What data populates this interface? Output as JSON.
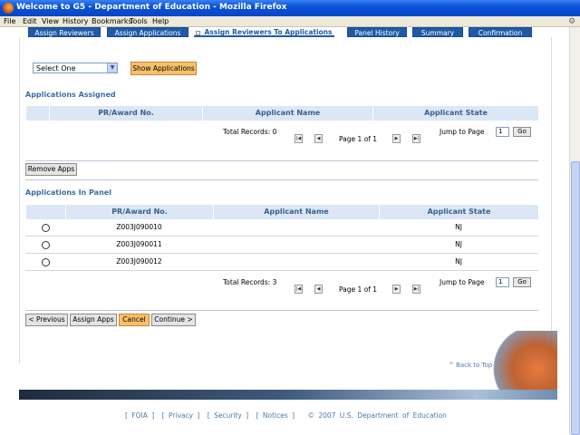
{
  "window": {
    "title": "Welcome to G5 - Department of Education - Mozilla Firefox"
  },
  "menu": [
    "File",
    "Edit",
    "View",
    "History",
    "Bookmarks",
    "Tools",
    "Help"
  ],
  "tabs": [
    {
      "label": "Assign Reviewers",
      "active": false
    },
    {
      "label": "Assign Applications",
      "active": false
    },
    {
      "label": "Assign Reviewers To Applications",
      "active": true
    },
    {
      "label": "Panel History",
      "active": false
    },
    {
      "label": "Summary",
      "active": false
    },
    {
      "label": "Confirmation",
      "active": false
    }
  ],
  "filter": {
    "select_value": "Select One",
    "show_button": "Show Applications"
  },
  "assigned": {
    "title": "Applications Assigned",
    "columns": [
      "PR/Award No.",
      "Applicant Name",
      "Applicant State"
    ],
    "total": "Total Records: 0",
    "page_label": "Page 1 of 1",
    "jump_label": "Jump to Page",
    "page_value": "1",
    "go_label": "Go",
    "remove_button": "Remove Apps"
  },
  "panel": {
    "title": "Applications In Panel",
    "columns": [
      "PR/Award No.",
      "Applicant Name",
      "Applicant State"
    ],
    "rows": [
      {
        "award": "Z003J090010",
        "name": "",
        "state": "NJ"
      },
      {
        "award": "Z003J090011",
        "name": "",
        "state": "NJ"
      },
      {
        "award": "Z003J090012",
        "name": "",
        "state": "NJ"
      }
    ],
    "total": "Total Records: 3",
    "page_label": "Page 1 of 1",
    "jump_label": "Jump to Page",
    "page_value": "1",
    "go_label": "Go"
  },
  "actions": {
    "previous": "< Previous",
    "assign": "Assign Apps",
    "cancel": "Cancel",
    "continue": "Continue >"
  },
  "back_to_top": "^ Back to Top",
  "footer": {
    "foia": "[ FOIA ]",
    "privacy": "[ Privacy ]",
    "security": "[ Security ]",
    "notices": "[ Notices ]",
    "copyright": "© 2007 U.S. Department of Education"
  }
}
